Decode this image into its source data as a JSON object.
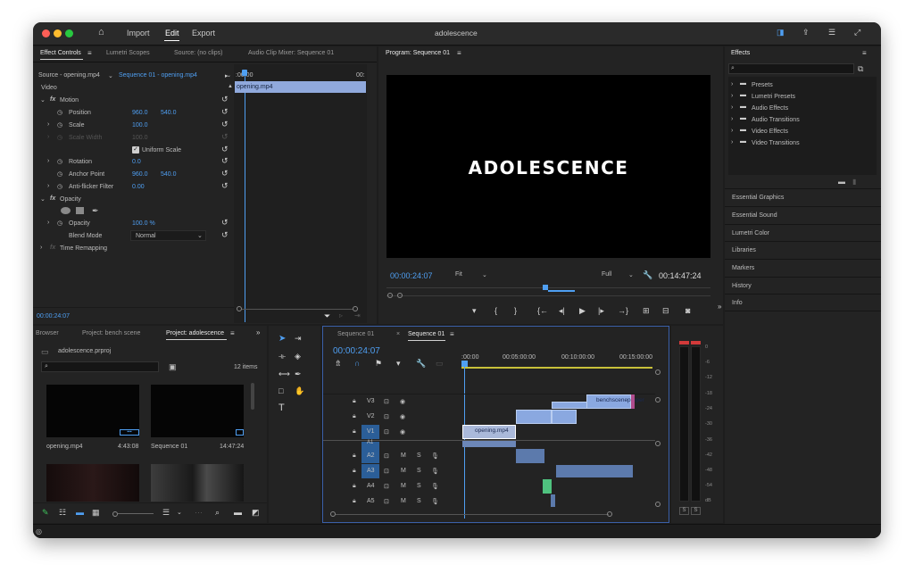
{
  "titlebar": {
    "nav_import": "Import",
    "nav_edit": "Edit",
    "nav_export": "Export",
    "title": "adolescence"
  },
  "effect_controls": {
    "tabs": [
      "Effect Controls",
      "Lumetri Scopes",
      "Source: (no clips)",
      "Audio Clip Mixer: Sequence 01"
    ],
    "source": "Source - opening.mp4",
    "sequence": "Sequence 01 - opening.mp4",
    "ruler_start": ":00:00",
    "ruler_end": "00:",
    "clip_name": "opening.mp4",
    "video_label": "Video",
    "motion": "Motion",
    "position_label": "Position",
    "position_x": "960.0",
    "position_y": "540.0",
    "scale_label": "Scale",
    "scale_val": "100.0",
    "scale_width_label": "Scale Width",
    "scale_width_val": "100.0",
    "uniform_scale": "Uniform Scale",
    "rotation_label": "Rotation",
    "rotation_val": "0.0",
    "anchor_label": "Anchor Point",
    "anchor_x": "960.0",
    "anchor_y": "540.0",
    "antiflicker_label": "Anti-flicker Filter",
    "antiflicker_val": "0.00",
    "opacity_section": "Opacity",
    "opacity_label": "Opacity",
    "opacity_val": "100.0 %",
    "blend_label": "Blend Mode",
    "blend_val": "Normal",
    "time_remap": "Time Remapping",
    "timecode": "00:00:24:07"
  },
  "program": {
    "tab": "Program: Sequence 01",
    "title_text": "ADOLESCENCE",
    "timecode": "00:00:24:07",
    "fit": "Fit",
    "quality": "Full",
    "duration": "00:14:47:24"
  },
  "effects": {
    "title": "Effects",
    "items": [
      "Presets",
      "Lumetri Presets",
      "Audio Effects",
      "Audio Transitions",
      "Video Effects",
      "Video Transitions"
    ],
    "sections": [
      "Essential Graphics",
      "Essential Sound",
      "Lumetri Color",
      "Libraries",
      "Markers",
      "History",
      "Info"
    ]
  },
  "project": {
    "tabs": [
      "Browser",
      "Project: bench scene",
      "Project: adolescence"
    ],
    "file": "adolescence.prproj",
    "count": "12 items",
    "media": [
      {
        "name": "opening.mp4",
        "dur": "4:43:08"
      },
      {
        "name": "Sequence 01",
        "dur": "14:47:24"
      }
    ]
  },
  "timeline": {
    "tabs": [
      "Sequence 01",
      "Sequence 01"
    ],
    "timecode": "00:00:24:07",
    "ruler": [
      ":00:00",
      "00:05:00:00",
      "00:10:00:00",
      "00:15:00:00"
    ],
    "video_tracks": [
      "V3",
      "V2",
      "V1"
    ],
    "audio_tracks": [
      "A1",
      "A2",
      "A3",
      "A4",
      "A5"
    ],
    "clip_v1": "opening.mp4",
    "clip_v3": "benchsceneproper",
    "meter_scale": [
      "0",
      "-6",
      "-12",
      "-18",
      "-24",
      "-30",
      "-36",
      "-42",
      "-48",
      "-54",
      "dB"
    ],
    "solo": [
      "S",
      "S"
    ]
  }
}
